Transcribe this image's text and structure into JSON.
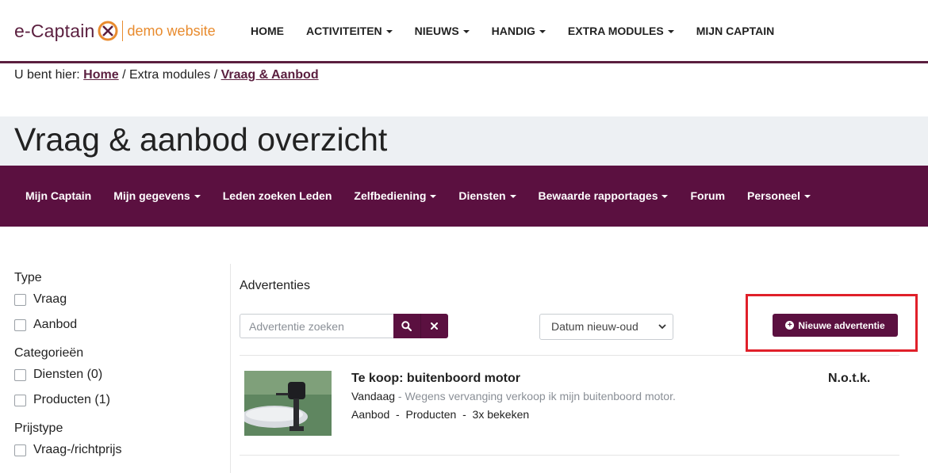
{
  "brand": {
    "name": "e-Captain",
    "tagline": "demo website",
    "primary_color": "#5b1040",
    "accent_color": "#e88b2e"
  },
  "main_nav": [
    {
      "label": "HOME",
      "dropdown": false
    },
    {
      "label": "ACTIVITEITEN",
      "dropdown": true
    },
    {
      "label": "NIEUWS",
      "dropdown": true
    },
    {
      "label": "HANDIG",
      "dropdown": true
    },
    {
      "label": "EXTRA MODULES",
      "dropdown": true
    },
    {
      "label": "MIJN CAPTAIN",
      "dropdown": false
    }
  ],
  "breadcrumb": {
    "prefix": "U bent hier:",
    "items": [
      "Home",
      "Extra modules",
      "Vraag & Aanbod"
    ],
    "separator": "/"
  },
  "page_title": "Vraag & aanbod overzicht",
  "sub_nav": [
    {
      "label": "Mijn Captain",
      "dropdown": false
    },
    {
      "label": "Mijn gegevens",
      "dropdown": true
    },
    {
      "label": "Leden zoeken Leden",
      "dropdown": false
    },
    {
      "label": "Zelfbediening",
      "dropdown": true
    },
    {
      "label": "Diensten",
      "dropdown": true
    },
    {
      "label": "Bewaarde rapportages",
      "dropdown": true
    },
    {
      "label": "Forum",
      "dropdown": false
    },
    {
      "label": "Personeel",
      "dropdown": true
    }
  ],
  "sidebar": {
    "groups": [
      {
        "heading": "Type",
        "options": [
          "Vraag",
          "Aanbod"
        ]
      },
      {
        "heading": "Categorieën",
        "options": [
          "Diensten (0)",
          "Producten (1)"
        ]
      },
      {
        "heading": "Prijstype",
        "options": [
          "Vraag-/richtprijs"
        ]
      }
    ]
  },
  "main": {
    "section_title": "Advertenties",
    "search": {
      "placeholder": "Advertentie zoeken",
      "value": ""
    },
    "sort": {
      "selected": "Datum nieuw-oud"
    },
    "new_button_label": "Nieuwe advertentie",
    "highlight_color": "#e0202a"
  },
  "listings": [
    {
      "title": "Te koop: buitenboord motor",
      "date": "Vandaag",
      "dash": " - ",
      "description": "Wegens vervanging verkoop ik mijn buitenboord motor.",
      "meta": "Aanbod  -  Producten  -  3x bekeken",
      "price": "N.o.t.k."
    }
  ]
}
